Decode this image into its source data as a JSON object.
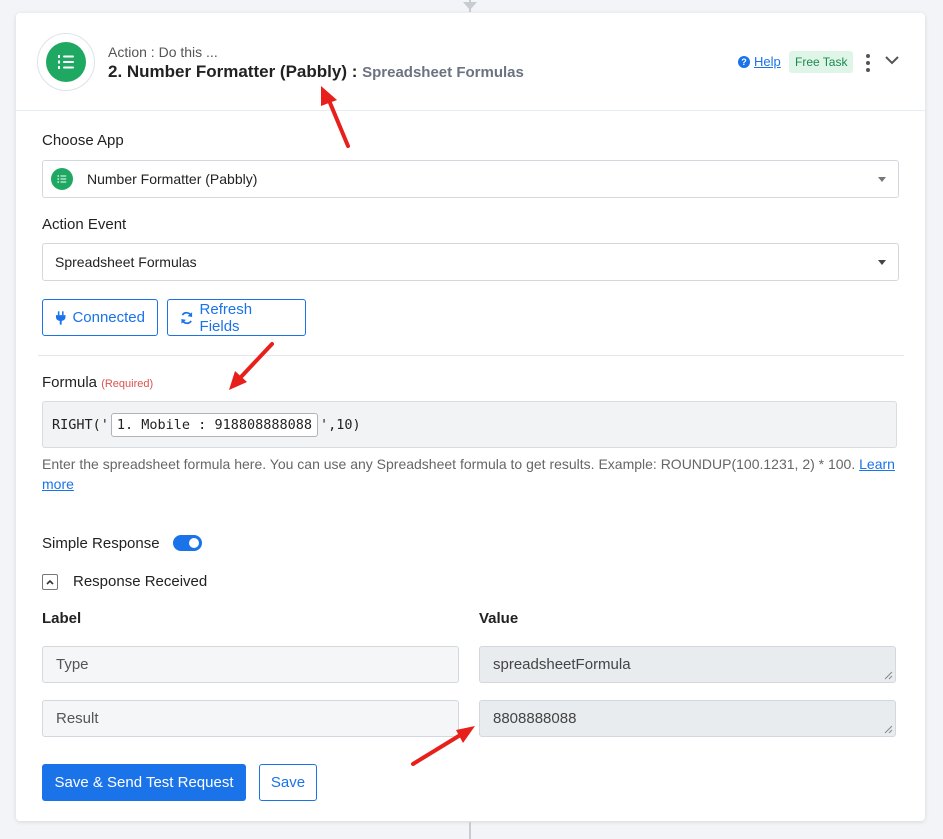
{
  "header": {
    "subtitle": "Action : Do this ...",
    "title": "2. Number Formatter (Pabbly) : ",
    "event": "Spreadsheet Formulas",
    "help_label": "Help",
    "badge": "Free Task"
  },
  "choose_app": {
    "label": "Choose App",
    "value": "Number Formatter (Pabbly)"
  },
  "action_event": {
    "label": "Action Event",
    "value": "Spreadsheet Formulas"
  },
  "buttons": {
    "connected": "Connected",
    "refresh": "Refresh Fields",
    "save_test": "Save & Send Test Request",
    "save": "Save"
  },
  "formula": {
    "label": "Formula",
    "required": "(Required)",
    "prefix": "RIGHT('",
    "pill": "1. Mobile : 918808888088",
    "suffix": "',10)",
    "help": "Enter the spreadsheet formula here. You can use any Spreadsheet formula to get results. Example: ROUNDUP(100.1231, 2) * 100.",
    "learn_more": "Learn more"
  },
  "simple_response": {
    "label": "Simple Response",
    "enabled": true
  },
  "response_received": {
    "label": "Response Received",
    "columns": {
      "label": "Label",
      "value": "Value"
    },
    "rows": [
      {
        "label": "Type",
        "value": "spreadsheetFormula"
      },
      {
        "label": "Result",
        "value": "8808888088"
      }
    ]
  },
  "colors": {
    "accent": "#1a73e8",
    "brand_green": "#1fa862",
    "annotation_red": "#e8201c"
  }
}
